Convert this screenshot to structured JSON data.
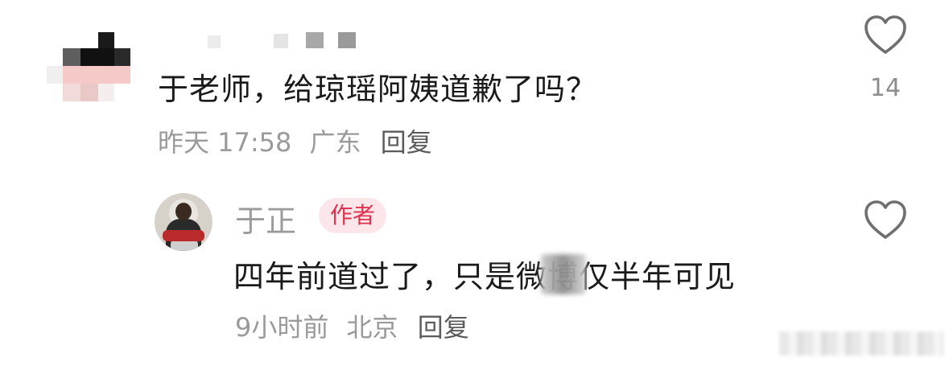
{
  "comment": {
    "text": "于老师，给琼瑶阿姨道歉了吗？",
    "time": "昨天 17:58",
    "location": "广东",
    "reply_label": "回复",
    "like_count": "14"
  },
  "reply": {
    "author": "于正",
    "badge": "作者",
    "text": "四年前道过了，只是微博仅半年可见",
    "time": "9小时前",
    "location": "北京",
    "reply_label": "回复"
  },
  "colors": {
    "badge_bg": "#fde6ea",
    "badge_text": "#e0324f",
    "meta_text": "#9a9a9a",
    "body_text": "#1a1a1a"
  },
  "icons": [
    "heart-icon",
    "heart-icon"
  ]
}
